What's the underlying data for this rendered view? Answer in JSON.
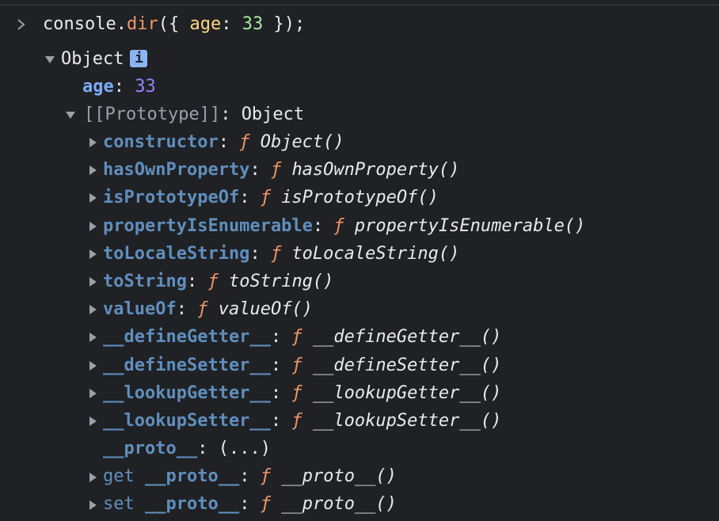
{
  "prompt": {
    "code": {
      "obj": "console",
      "dot": ".",
      "method": "dir",
      "open": "({ ",
      "key": "age",
      "colon": ": ",
      "value": "33",
      "close": " });"
    }
  },
  "tree": {
    "root": {
      "label": "Object",
      "info_badge": "i",
      "age_key": "age",
      "age_value": "33"
    },
    "prototype": {
      "label": "[[Prototype]]",
      "value": "Object",
      "items": [
        {
          "key": "constructor",
          "sig": "Object()"
        },
        {
          "key": "hasOwnProperty",
          "sig": "hasOwnProperty()"
        },
        {
          "key": "isPrototypeOf",
          "sig": "isPrototypeOf()"
        },
        {
          "key": "propertyIsEnumerable",
          "sig": "propertyIsEnumerable()"
        },
        {
          "key": "toLocaleString",
          "sig": "toLocaleString()"
        },
        {
          "key": "toString",
          "sig": "toString()"
        },
        {
          "key": "valueOf",
          "sig": "valueOf()"
        },
        {
          "key": "__defineGetter__",
          "sig": "__defineGetter__()"
        },
        {
          "key": "__defineSetter__",
          "sig": "__defineSetter__()"
        },
        {
          "key": "__lookupGetter__",
          "sig": "__lookupGetter__()"
        },
        {
          "key": "__lookupSetter__",
          "sig": "__lookupSetter__()"
        }
      ],
      "proto_key": "__proto__",
      "proto_value": "(...)",
      "getter": {
        "prefix": "get",
        "key": "__proto__",
        "sig": "__proto__()"
      },
      "setter": {
        "prefix": "set",
        "key": "__proto__",
        "sig": "__proto__()"
      }
    },
    "function_marker": "ƒ"
  },
  "icons": {
    "prompt": "chevron-right-icon",
    "expanded": "triangle-down-icon",
    "collapsed": "triangle-right-icon"
  }
}
